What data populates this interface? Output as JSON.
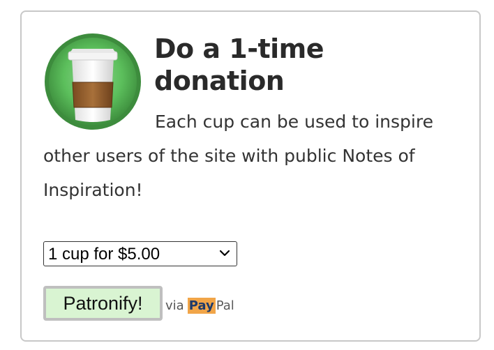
{
  "donation": {
    "title": "Do a 1-time donation",
    "description": "Each cup can be used to inspire other users of the site with public Notes of Inspiration!",
    "select": {
      "selected": "1 cup for $5.00",
      "options": [
        "1 cup for $5.00"
      ]
    },
    "button_label": "Patronify!",
    "via_label": "via",
    "paypal_pay": "Pay",
    "paypal_pal": "Pal",
    "icon": "coffee-cup-icon"
  },
  "colors": {
    "button_bg": "#d9f4d2",
    "cup_circle": "#4caf50",
    "paypal_pay_bg": "#f1a548",
    "card_border": "#c8c8c8"
  }
}
